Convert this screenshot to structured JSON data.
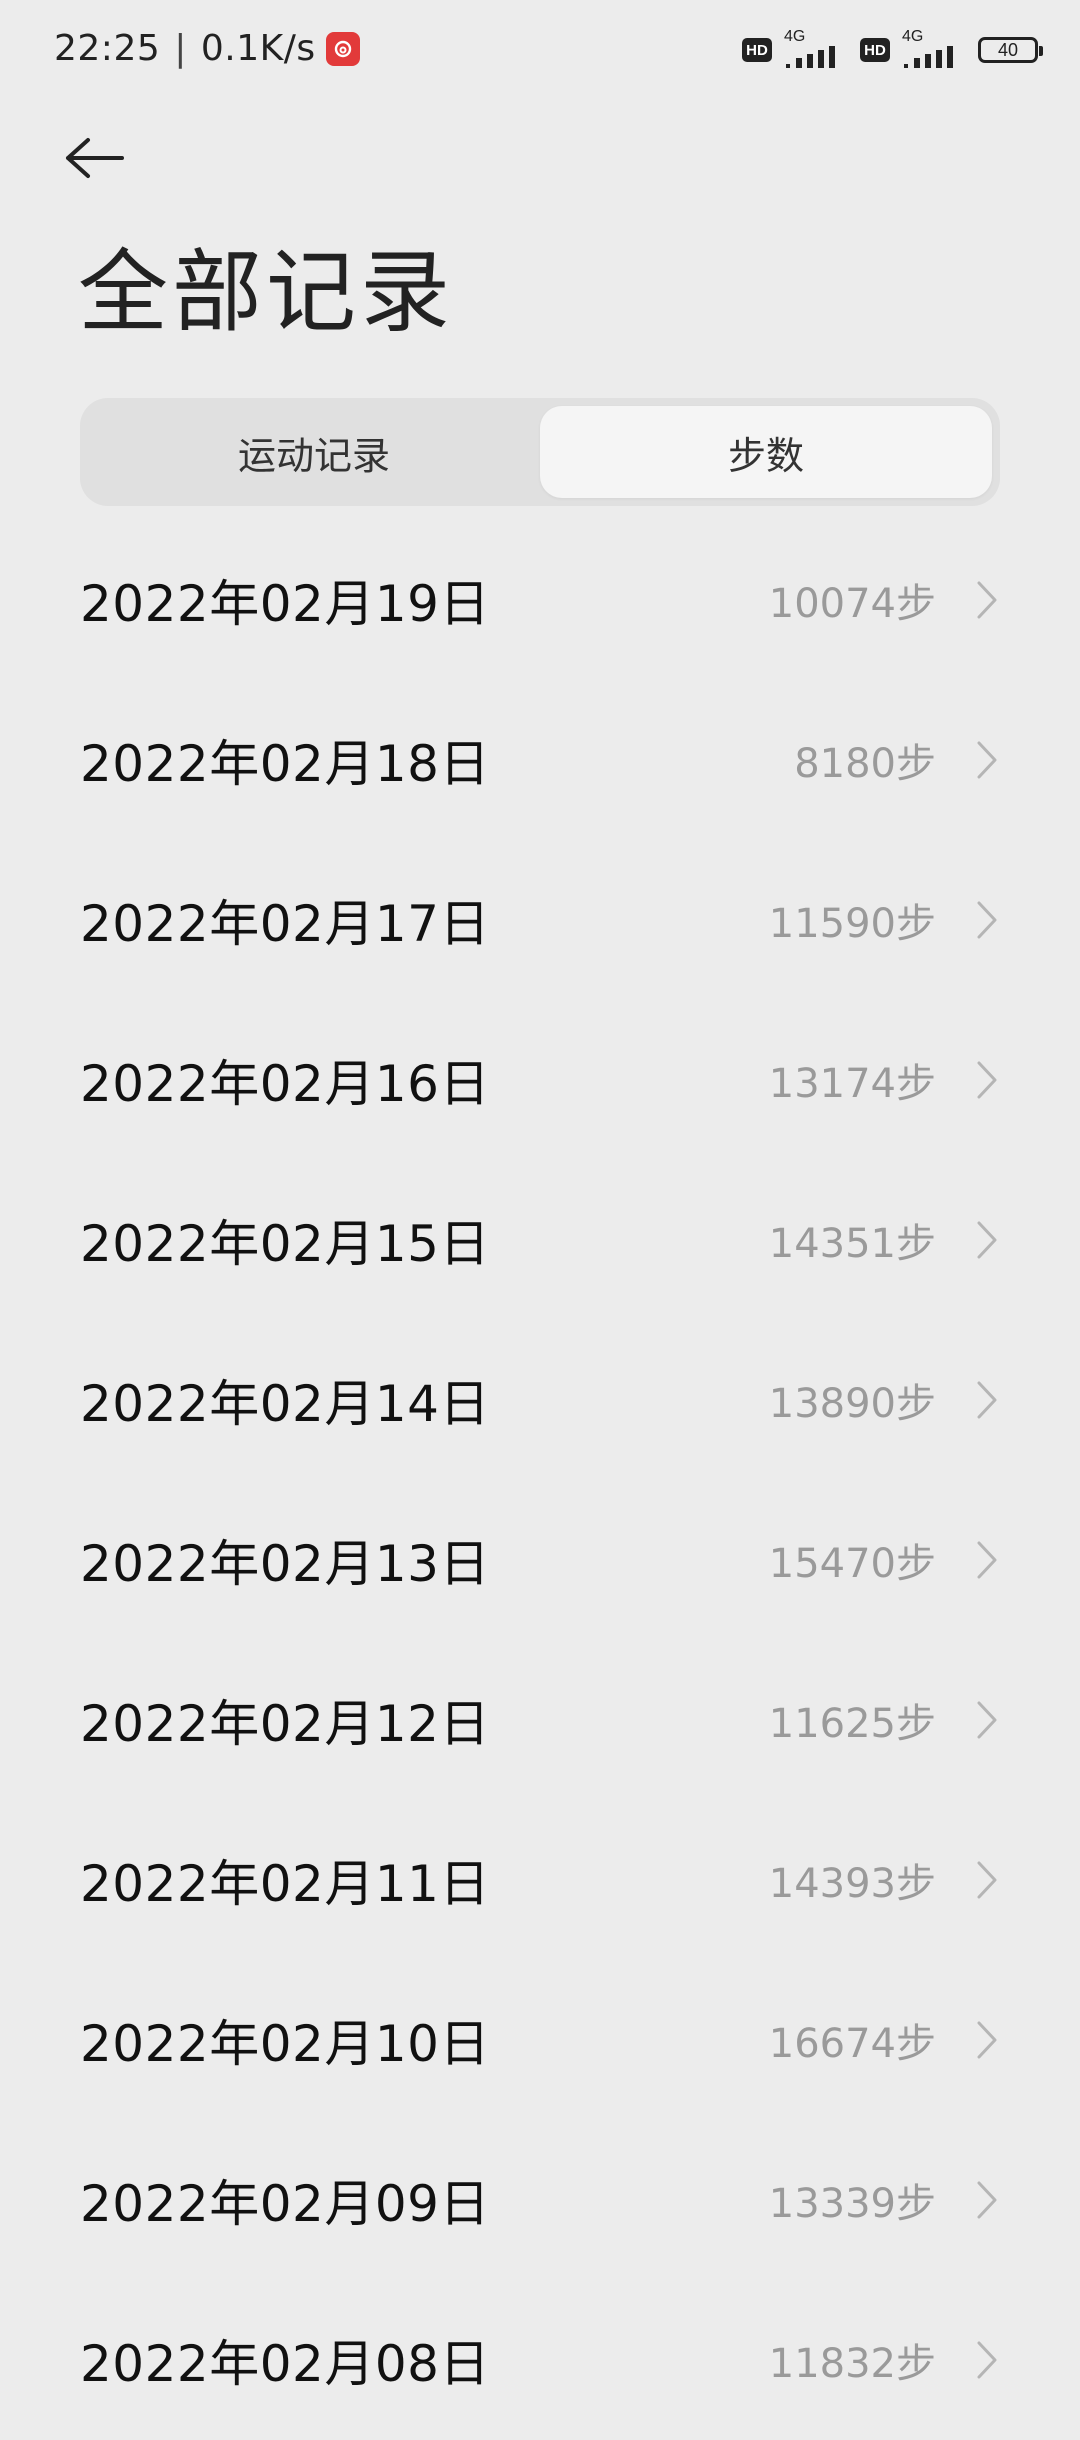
{
  "status_bar": {
    "time": "22:25",
    "separator": "|",
    "net_speed": "0.1K/s",
    "hd1": "HD",
    "net1": "4G",
    "hd2": "HD",
    "net2": "4G",
    "battery": "40"
  },
  "header": {
    "title": "全部记录"
  },
  "tabs": [
    {
      "label": "运动记录",
      "active": false
    },
    {
      "label": "步数",
      "active": true
    }
  ],
  "records": [
    {
      "date": "2022年02月19日",
      "steps": "10074步"
    },
    {
      "date": "2022年02月18日",
      "steps": "8180步"
    },
    {
      "date": "2022年02月17日",
      "steps": "11590步"
    },
    {
      "date": "2022年02月16日",
      "steps": "13174步"
    },
    {
      "date": "2022年02月15日",
      "steps": "14351步"
    },
    {
      "date": "2022年02月14日",
      "steps": "13890步"
    },
    {
      "date": "2022年02月13日",
      "steps": "15470步"
    },
    {
      "date": "2022年02月12日",
      "steps": "11625步"
    },
    {
      "date": "2022年02月11日",
      "steps": "14393步"
    },
    {
      "date": "2022年02月10日",
      "steps": "16674步"
    },
    {
      "date": "2022年02月09日",
      "steps": "13339步"
    },
    {
      "date": "2022年02月08日",
      "steps": "11832步"
    }
  ],
  "colors": {
    "background": "#ececec",
    "steps_text": "#9a9a9a",
    "netease_red": "#e23a3a"
  },
  "icons": {
    "back": "arrow-left-icon",
    "chevron": "chevron-right-icon",
    "app": "netease-music-icon"
  }
}
